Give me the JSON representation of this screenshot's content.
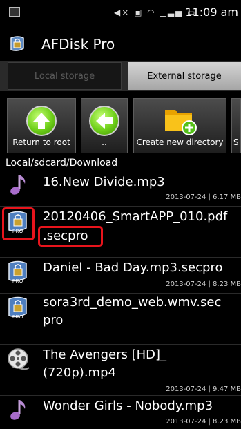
{
  "status": {
    "time": "11:09 am"
  },
  "app": {
    "title": "AFDisk Pro"
  },
  "tabs": [
    {
      "label": "Local storage"
    },
    {
      "label": "External storage"
    }
  ],
  "toolbar": [
    {
      "label": "Return to root"
    },
    {
      "label": ".."
    },
    {
      "label": "Create new directory"
    },
    {
      "label": "S"
    }
  ],
  "path": "Local/sdcard/Download",
  "files": [
    {
      "name": "16.New Divide.mp3",
      "meta": "2013-07-24 | 6.17 MB",
      "icon": "music-note-icon"
    },
    {
      "name": "20120406_SmartAPP_010.pdf",
      "name2": ".secpro",
      "icon": "secpro-file-icon"
    },
    {
      "name": "Daniel - Bad Day.mp3.secpro",
      "meta": "2013-07-24 | 8.23 MB",
      "icon": "secpro-file-icon"
    },
    {
      "name": "sora3rd_demo_web.wmv.sec",
      "name2": "pro",
      "icon": "secpro-file-icon"
    },
    {
      "name": "The Avengers [HD]_",
      "name2": "(720p).mp4",
      "meta": "2013-07-24 | 9.47 MB",
      "icon": "film-reel-icon"
    },
    {
      "name": "Wonder Girls - Nobody.mp3",
      "meta": "2013-07-24 | 8.23 MB",
      "icon": "music-note-icon"
    }
  ],
  "colors": {
    "highlight": "#e8141c",
    "accent_green": "#6ecf1a",
    "folder_yellow": "#f5b400"
  }
}
